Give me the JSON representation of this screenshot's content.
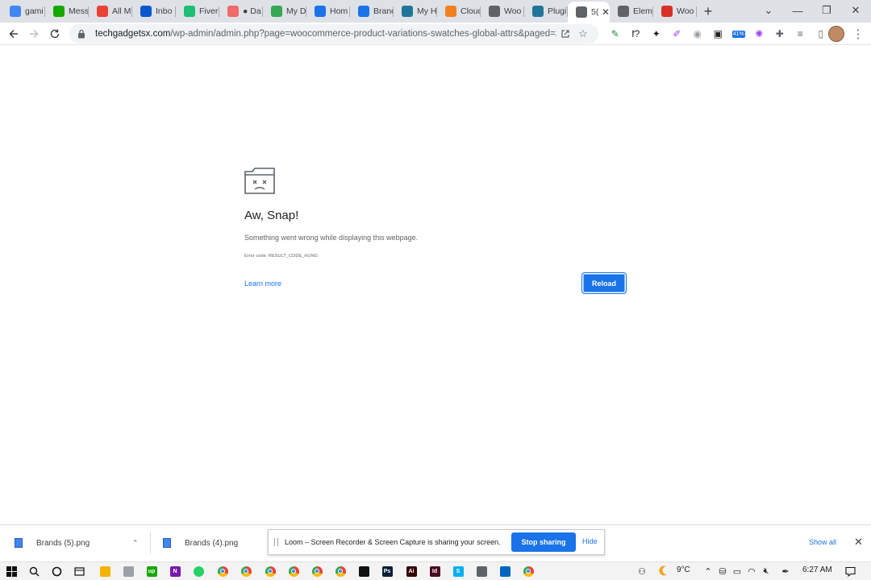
{
  "browser": {
    "tabs": [
      {
        "label": "gami",
        "icon": "gemini-sparkle-icon",
        "color": "#4285f4"
      },
      {
        "label": "Mess",
        "icon": "upwork-icon",
        "color": "#14a800"
      },
      {
        "label": "All M",
        "icon": "gmail-icon",
        "color": "#ea4335"
      },
      {
        "label": "Inbo",
        "icon": "mail-icon",
        "color": "#0b57d0"
      },
      {
        "label": "Fiverr",
        "icon": "fiverr-icon",
        "color": "#1dbf73"
      },
      {
        "label": "● Da",
        "icon": "asana-icon",
        "color": "#f06a6a"
      },
      {
        "label": "My D",
        "icon": "google-drive-icon",
        "color": "#34a853"
      },
      {
        "label": "Hom",
        "icon": "globe-icon",
        "color": "#1a73e8"
      },
      {
        "label": "Branc",
        "icon": "globe-icon",
        "color": "#1a73e8"
      },
      {
        "label": "My H",
        "icon": "wordpress-icon",
        "color": "#21759b"
      },
      {
        "label": "Cloud",
        "icon": "cloudflare-icon",
        "color": "#f38020"
      },
      {
        "label": "Woo",
        "icon": "folder-tab-icon",
        "color": "#5f6368"
      },
      {
        "label": "Plugi",
        "icon": "wordpress-icon",
        "color": "#21759b"
      },
      {
        "label": "5(",
        "icon": "sad-tab-icon",
        "color": "#5f6368",
        "active": true
      },
      {
        "label": "Elem",
        "icon": "folder-tab-icon",
        "color": "#5f6368"
      },
      {
        "label": "Woo",
        "icon": "yoast-icon",
        "color": "#d93025"
      }
    ],
    "new_tab_label": "+",
    "url_host": "techgadgetsx.com",
    "url_path": "/wp-admin/admin.php?page=woocommerce-product-variations-swatches-global-attrs&paged=2...",
    "extensions": [
      {
        "icon": "eyedropper-extension-icon",
        "glyph": "✎",
        "color": "#1e8e3e"
      },
      {
        "icon": "function-extension-icon",
        "glyph": "f?",
        "color": "#202124"
      },
      {
        "icon": "butterfly-extension-icon",
        "glyph": "✦",
        "color": "#202124"
      },
      {
        "icon": "pen-extension-icon",
        "glyph": "✐",
        "color": "#a142f4"
      },
      {
        "icon": "camera-extension-icon",
        "glyph": "◉",
        "color": "#9aa0a6"
      },
      {
        "icon": "frame-extension-icon",
        "glyph": "▣",
        "color": "#202124"
      },
      {
        "icon": "battery-extension-icon",
        "glyph": "41%",
        "color": "#ea4335"
      },
      {
        "icon": "color-wheel-extension-icon",
        "glyph": "✺",
        "color": "#a142f4"
      },
      {
        "icon": "puzzle-extensions-icon",
        "glyph": "✚",
        "color": "#5f6368"
      },
      {
        "icon": "reading-list-icon",
        "glyph": "≡",
        "color": "#5f6368"
      },
      {
        "icon": "side-panel-icon",
        "glyph": "▯",
        "color": "#5f6368"
      }
    ]
  },
  "error_page": {
    "title": "Aw, Snap!",
    "message": "Something went wrong while displaying this webpage.",
    "error_code": "Error code: RESULT_CODE_HUNG",
    "learn_more": "Learn more",
    "reload": "Reload"
  },
  "downloads": {
    "items": [
      {
        "name": "Brands (5).png"
      },
      {
        "name": "Brands (4).png"
      }
    ],
    "show_all": "Show all"
  },
  "screen_share": {
    "message": "Loom – Screen Recorder & Screen Capture is sharing your screen.",
    "stop_label": "Stop sharing",
    "hide_label": "Hide"
  },
  "taskbar": {
    "weather_temp": "9°C",
    "time": "6:27 AM"
  }
}
